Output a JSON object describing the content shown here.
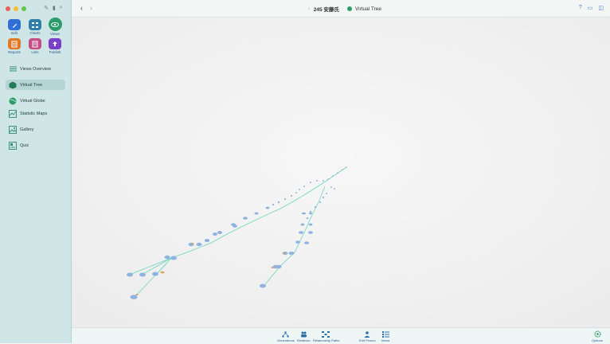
{
  "sidebar": {
    "modules": [
      {
        "label": "Edit",
        "color": "#2f6fd6"
      },
      {
        "label": "Charts",
        "color": "#2f7fa8"
      },
      {
        "label": "Views",
        "color": "#2c9c6c"
      },
      {
        "label": "Reports",
        "color": "#e07a2a"
      },
      {
        "label": "Lists",
        "color": "#c34e8a"
      },
      {
        "label": "Publish",
        "color": "#7a3ec9"
      }
    ],
    "items": [
      {
        "label": "Views Overview",
        "icon": "list-icon"
      },
      {
        "label": "Virtual Tree",
        "icon": "tree-cube-icon",
        "active": true
      },
      {
        "label": "Virtual Globe",
        "icon": "globe-icon"
      },
      {
        "label": "Statistic Maps",
        "icon": "map-icon"
      },
      {
        "label": "Gallery",
        "icon": "image-icon"
      },
      {
        "label": "Quiz",
        "icon": "quiz-icon"
      }
    ]
  },
  "header": {
    "person": "245 安藤氏",
    "view": "Virtual Tree"
  },
  "bottom": {
    "buttons": [
      {
        "label": "Generations"
      },
      {
        "label": "Relatives"
      },
      {
        "label": "Relationship Paths"
      },
      {
        "label": "Edit Person"
      },
      {
        "label": "Views"
      },
      {
        "label": "Options"
      }
    ]
  },
  "colors": {
    "accent": "#2c9c6c",
    "sidebar_bg": "#cfe5e6",
    "node": "#8fb3e0",
    "link": "#6cd6b8"
  }
}
